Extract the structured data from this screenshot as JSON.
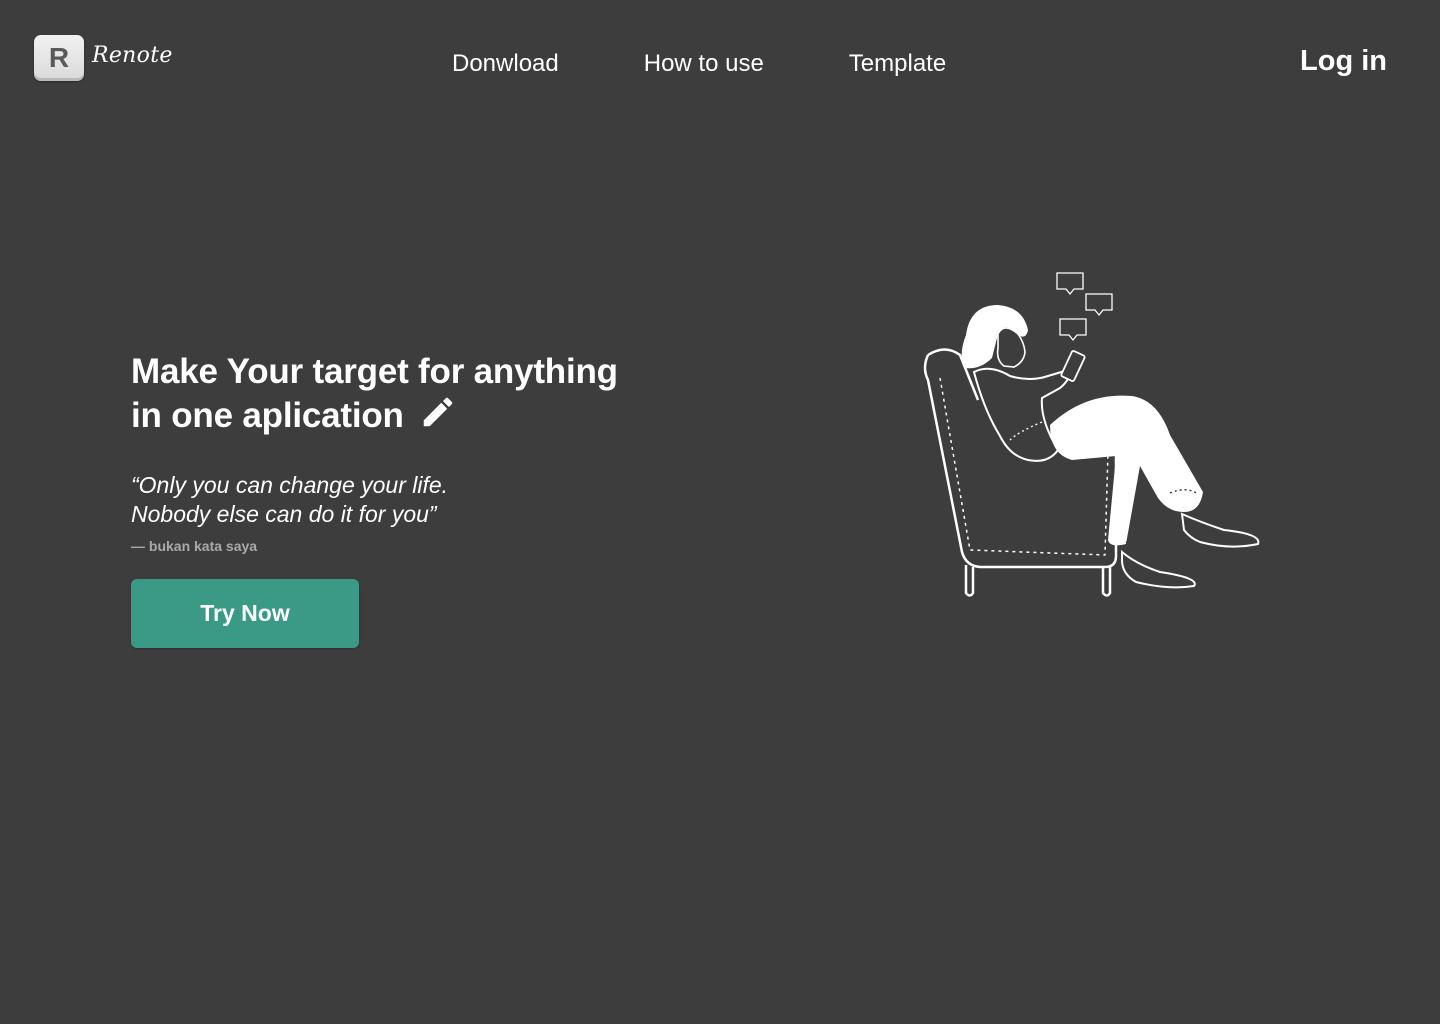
{
  "brand": {
    "logo_letter": "R",
    "name": "Renote"
  },
  "nav": {
    "items": [
      {
        "label": "Donwload"
      },
      {
        "label": "How to use"
      },
      {
        "label": "Template"
      }
    ],
    "login_label": "Log in"
  },
  "hero": {
    "headline_line1": "Make Your target for anything",
    "headline_line2": "in one aplication",
    "quote_line1": "“Only you can change your life.",
    "quote_line2": "Nobody else can do it for you”",
    "attribution": "— bukan kata saya",
    "cta_label": "Try Now"
  },
  "colors": {
    "background": "#3d3d3d",
    "accent": "#3a9a86",
    "text": "#ffffff",
    "muted": "#a9a9a9"
  },
  "icons": {
    "edit": "pencil-icon",
    "illustration": "woman-in-armchair-with-phone"
  }
}
